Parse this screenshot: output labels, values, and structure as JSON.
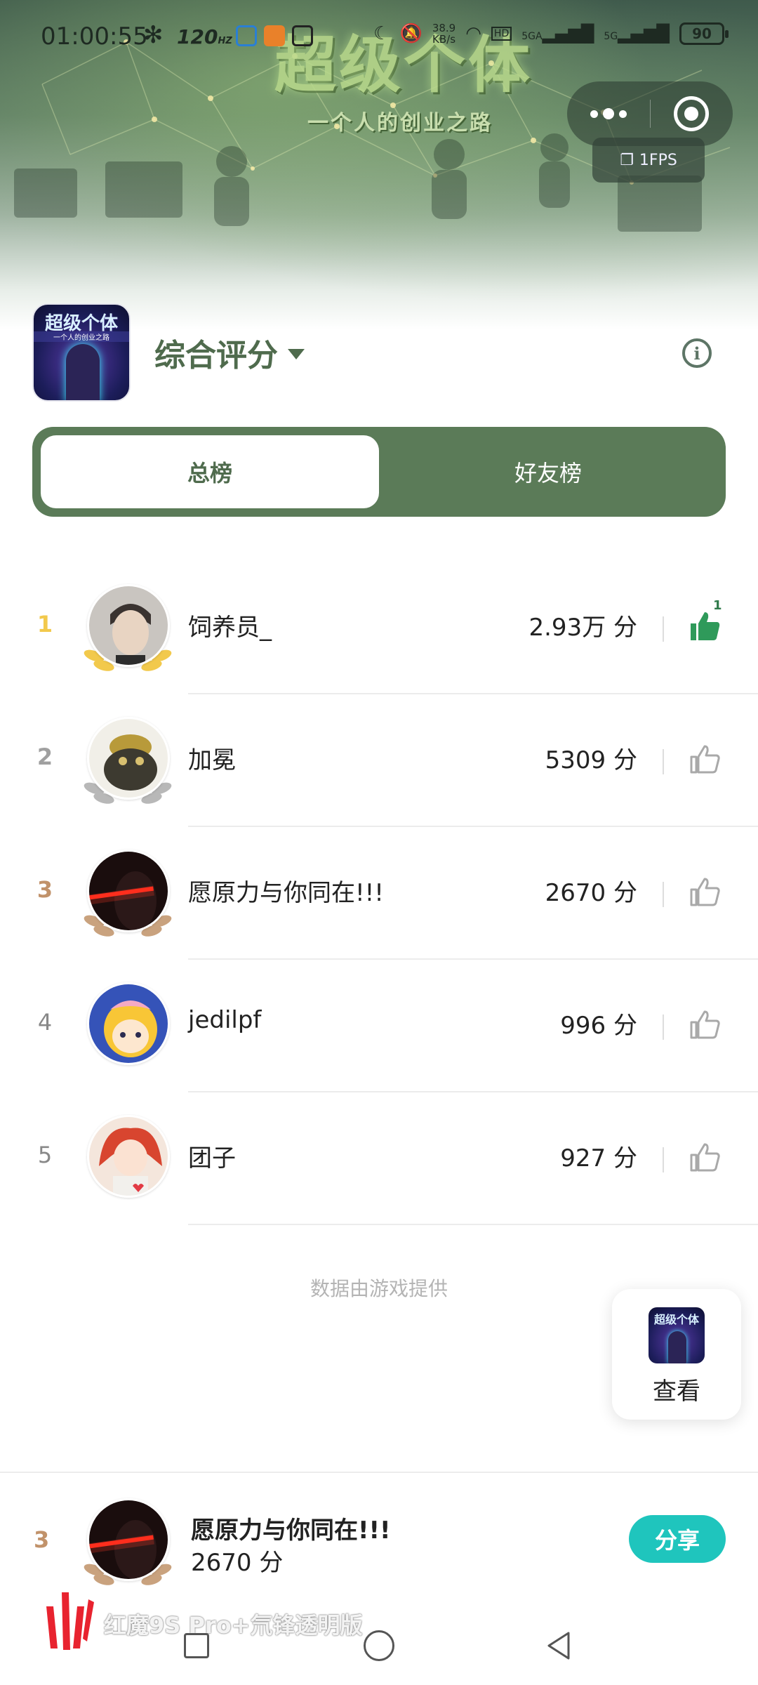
{
  "status_bar": {
    "time": "01:00:55",
    "refresh_rate": "120",
    "refresh_unit": "HZ",
    "network_speed": "38.9",
    "network_unit": "KB/s",
    "sim1_label": "5GA",
    "sim2_label": "5G",
    "battery": "90"
  },
  "banner": {
    "title": "超级个体",
    "subtitle": "一个人的创业之路"
  },
  "capsule": {
    "fps": "1FPS"
  },
  "header": {
    "game_icon_title": "超级个体",
    "game_icon_subtitle": "一个人的创业之路",
    "rating_mode": "综合评分"
  },
  "tabs": [
    {
      "label": "总榜",
      "active": true
    },
    {
      "label": "好友榜",
      "active": false
    }
  ],
  "leaderboard": [
    {
      "rank": "1",
      "name": "饲养员_",
      "score": "2.93万 分",
      "liked": true,
      "likes": "1",
      "rank_color": "#f2c94c",
      "laurel_color": "#f2c94c"
    },
    {
      "rank": "2",
      "name": "加冕",
      "score": "5309 分",
      "liked": false,
      "likes": "",
      "rank_color": "#a0a0a0",
      "laurel_color": "#b8b8b8"
    },
    {
      "rank": "3",
      "name": "愿原力与你同在!!!",
      "score": "2670 分",
      "liked": false,
      "likes": "",
      "rank_color": "#c1926a",
      "laurel_color": "#c9a27e"
    },
    {
      "rank": "4",
      "name": "jedilpf",
      "score": "996 分",
      "liked": false,
      "likes": "",
      "rank_color": "#888888",
      "laurel_color": ""
    },
    {
      "rank": "5",
      "name": "团子",
      "score": "927 分",
      "liked": false,
      "likes": "",
      "rank_color": "#888888",
      "laurel_color": ""
    }
  ],
  "footnote": "数据由游戏提供",
  "view_card": {
    "icon_title": "超级个体",
    "label": "查看"
  },
  "my_rank": {
    "rank": "3",
    "name": "愿原力与你同在!!!",
    "score": "2670 分",
    "share_label": "分享"
  },
  "brand": {
    "text": "红魔9S Pro+氘锋透明版"
  },
  "colors": {
    "accent_green": "#5b7b58",
    "share_teal": "#1fc5bd",
    "like_green": "#2f9a5a"
  }
}
